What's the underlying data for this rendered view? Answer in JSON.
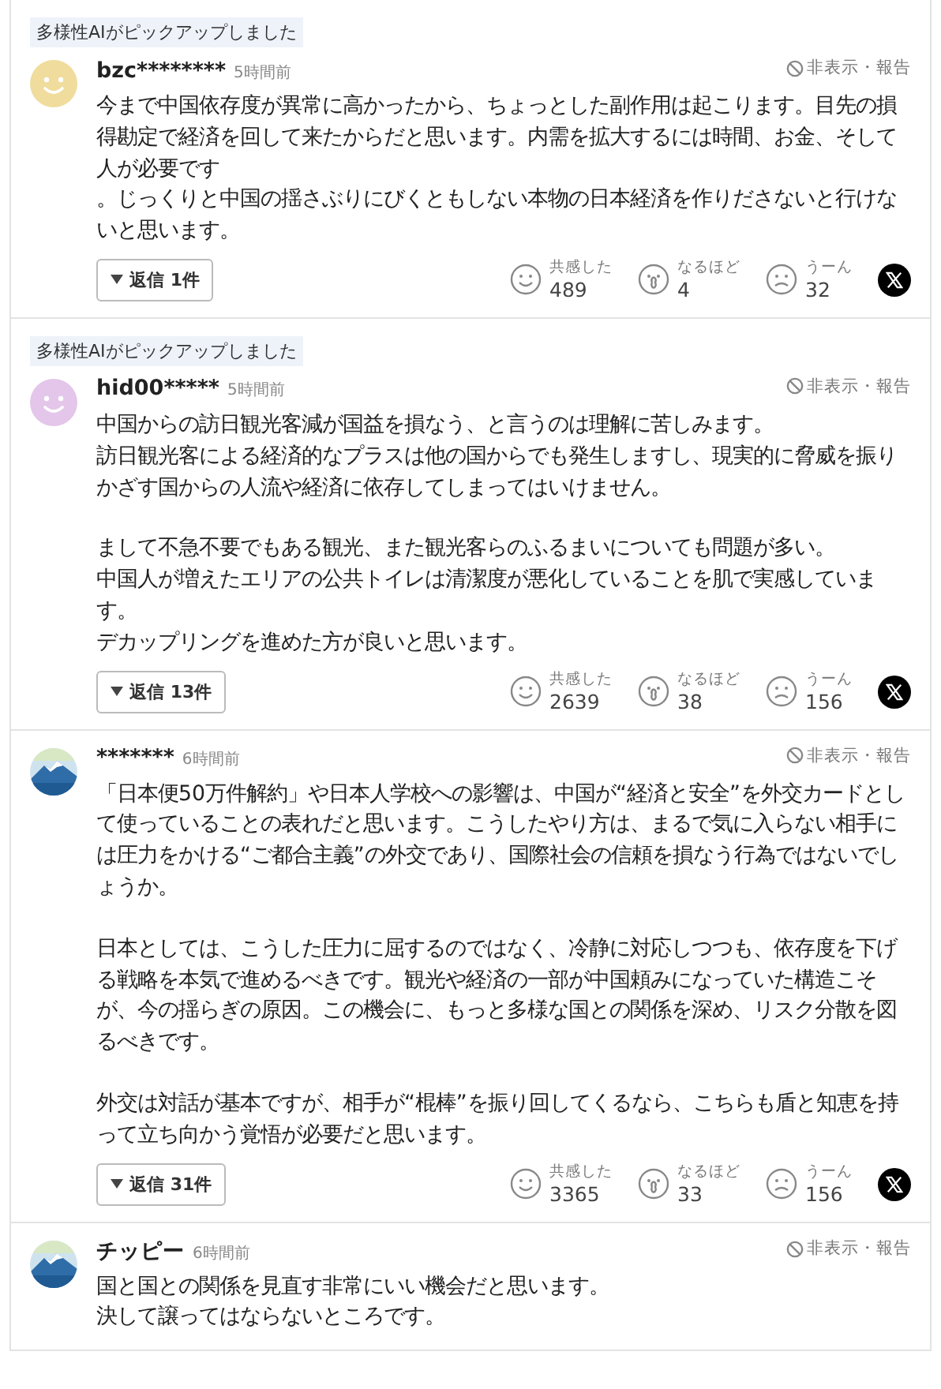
{
  "comments": [
    {
      "badge": "多様性AIがピックアップしました",
      "avatar": {
        "kind": "smiley",
        "color": "#f0dc9c"
      },
      "user": "bzc********",
      "time": "5時間前",
      "actions": "非表示・報告",
      "body": [
        [
          "今まで中国依存度が異常に高かったから、ちょっとした副作用は起こります。目先の損得勘定で経済を回して来たからだと思います。内需を拡大するには時間、お金、そして人が必要です",
          "。じっくりと中国の揺さぶりにびくともしない本物の日本経済を作りださないと行けないと思います。"
        ]
      ],
      "replies": "返信 1件",
      "reactions": [
        {
          "kind": "empathy",
          "label": "共感した",
          "count": "489"
        },
        {
          "kind": "insight",
          "label": "なるほど",
          "count": "4"
        },
        {
          "kind": "doubt",
          "label": "うーん",
          "count": "32"
        }
      ]
    },
    {
      "badge": "多様性AIがピックアップしました",
      "avatar": {
        "kind": "smiley",
        "color": "#e4c6ea"
      },
      "user": "hid00*****",
      "time": "5時間前",
      "actions": "非表示・報告",
      "body": [
        [
          "中国からの訪日観光客減が国益を損なう、と言うのは理解に苦しみます。",
          "訪日観光客による経済的なプラスは他の国からでも発生しますし、現実的に脅威を振りかざす国からの人流や経済に依存してしまってはいけません。"
        ],
        [
          "まして不急不要でもある観光、また観光客らのふるまいについても問題が多い。",
          "中国人が増えたエリアの公共トイレは清潔度が悪化していることを肌で実感しています。",
          "デカップリングを進めた方が良いと思います。"
        ]
      ],
      "replies": "返信 13件",
      "reactions": [
        {
          "kind": "empathy",
          "label": "共感した",
          "count": "2639"
        },
        {
          "kind": "insight",
          "label": "なるほど",
          "count": "38"
        },
        {
          "kind": "doubt",
          "label": "うーん",
          "count": "156"
        }
      ]
    },
    {
      "avatar": {
        "kind": "picture"
      },
      "user": "*******",
      "time": "6時間前",
      "actions": "非表示・報告",
      "body": [
        [
          "「日本便50万件解約」や日本人学校への影響は、中国が“経済と安全”を外交カードとして使っていることの表れだと思います。こうしたやり方は、まるで気に入らない相手には圧力をかける“ご都合主義”の外交であり、国際社会の信頼を損なう行為ではないでしょうか。"
        ],
        [
          "日本としては、こうした圧力に屈するのではなく、冷静に対応しつつも、依存度を下げる戦略を本気で進めるべきです。観光や経済の一部が中国頼みになっていた構造こそが、今の揺らぎの原因。この機会に、もっと多様な国との関係を深め、リスク分散を図るべきです。"
        ],
        [
          "外交は対話が基本ですが、相手が“棍棒”を振り回してくるなら、こちらも盾と知恵を持って立ち向かう覚悟が必要だと思います。"
        ]
      ],
      "replies": "返信 31件",
      "reactions": [
        {
          "kind": "empathy",
          "label": "共感した",
          "count": "3365"
        },
        {
          "kind": "insight",
          "label": "なるほど",
          "count": "33"
        },
        {
          "kind": "doubt",
          "label": "うーん",
          "count": "156"
        }
      ]
    },
    {
      "avatar": {
        "kind": "picture"
      },
      "user": "チッピー",
      "time": "6時間前",
      "actions": "非表示・報告",
      "body": [
        [
          "国と国との関係を見直す非常にいい機会だと思います。",
          "決して譲ってはならないところです。"
        ]
      ]
    }
  ]
}
